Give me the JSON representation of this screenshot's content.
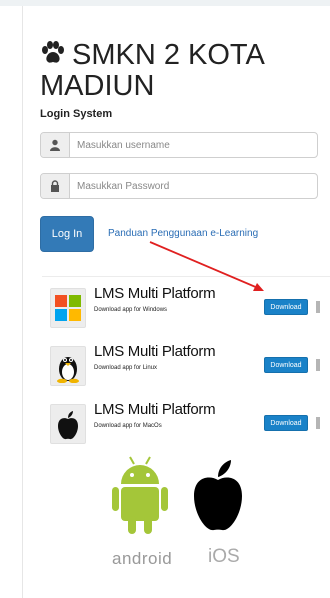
{
  "header": {
    "title": "SMKN 2 KOTA MADIUN",
    "subtitle": "Login System"
  },
  "form": {
    "username_placeholder": "Masukkan username",
    "password_placeholder": "Masukkan Password",
    "login_label": "Log In",
    "guide_link": "Panduan Penggunaan e-Learning"
  },
  "apps": [
    {
      "name": "LMS Multi Platform",
      "desc": "Download app for Windows",
      "button": "Download",
      "icon": "windows-icon"
    },
    {
      "name": "LMS Multi Platform",
      "desc": "Download app for Linux",
      "button": "Download",
      "icon": "linux-icon"
    },
    {
      "name": "LMS Multi Platform",
      "desc": "Download app for MacOs",
      "button": "Download",
      "icon": "apple-icon"
    }
  ],
  "logos": {
    "android_label": "android",
    "ios_label": "iOS"
  },
  "colors": {
    "primary": "#337ab7",
    "download": "#1a82c8",
    "link": "#2a6db5",
    "arrow": "#e02020",
    "android_green": "#a4c639"
  }
}
